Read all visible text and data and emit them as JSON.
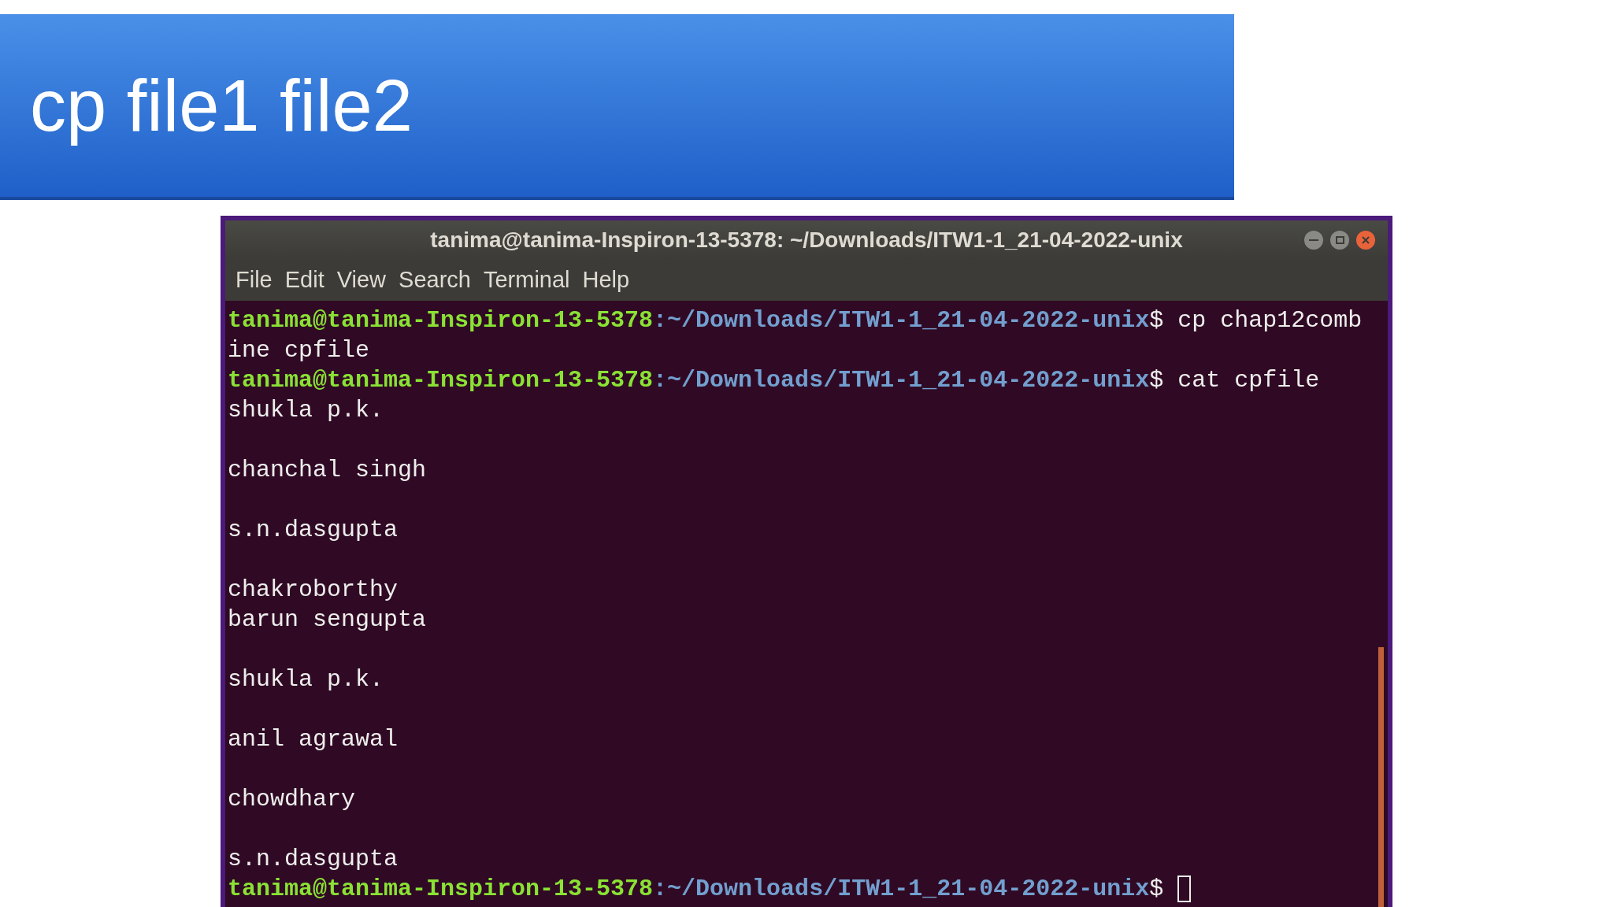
{
  "slide": {
    "title": "cp file1 file2"
  },
  "terminal": {
    "title": "tanima@tanima-Inspiron-13-5378: ~/Downloads/ITW1-1_21-04-2022-unix",
    "menu": [
      "File",
      "Edit",
      "View",
      "Search",
      "Terminal",
      "Help"
    ],
    "lines": [
      {
        "kind": "prompt",
        "user": "tanima@tanima-Inspiron-13-5378",
        "path": ":~/Downloads/ITW1-1_21-04-2022-unix",
        "command": "$ cp chap12comb"
      },
      {
        "kind": "output",
        "text": "ine cpfile"
      },
      {
        "kind": "prompt",
        "user": "tanima@tanima-Inspiron-13-5378",
        "path": ":~/Downloads/ITW1-1_21-04-2022-unix",
        "command": "$ cat cpfile"
      },
      {
        "kind": "output",
        "text": "shukla p.k."
      },
      {
        "kind": "blank"
      },
      {
        "kind": "output",
        "text": "chanchal singh"
      },
      {
        "kind": "blank"
      },
      {
        "kind": "output",
        "text": "s.n.dasgupta"
      },
      {
        "kind": "blank"
      },
      {
        "kind": "output",
        "text": "chakroborthy"
      },
      {
        "kind": "output",
        "text": "barun sengupta"
      },
      {
        "kind": "blank"
      },
      {
        "kind": "output",
        "text": "shukla p.k."
      },
      {
        "kind": "blank"
      },
      {
        "kind": "output",
        "text": "anil agrawal"
      },
      {
        "kind": "blank"
      },
      {
        "kind": "output",
        "text": "chowdhary"
      },
      {
        "kind": "blank"
      },
      {
        "kind": "output",
        "text": "s.n.dasgupta"
      },
      {
        "kind": "prompt",
        "user": "tanima@tanima-Inspiron-13-5378",
        "path": ":~/Downloads/ITW1-1_21-04-2022-unix",
        "command": "$ ",
        "cursor": true
      }
    ]
  }
}
